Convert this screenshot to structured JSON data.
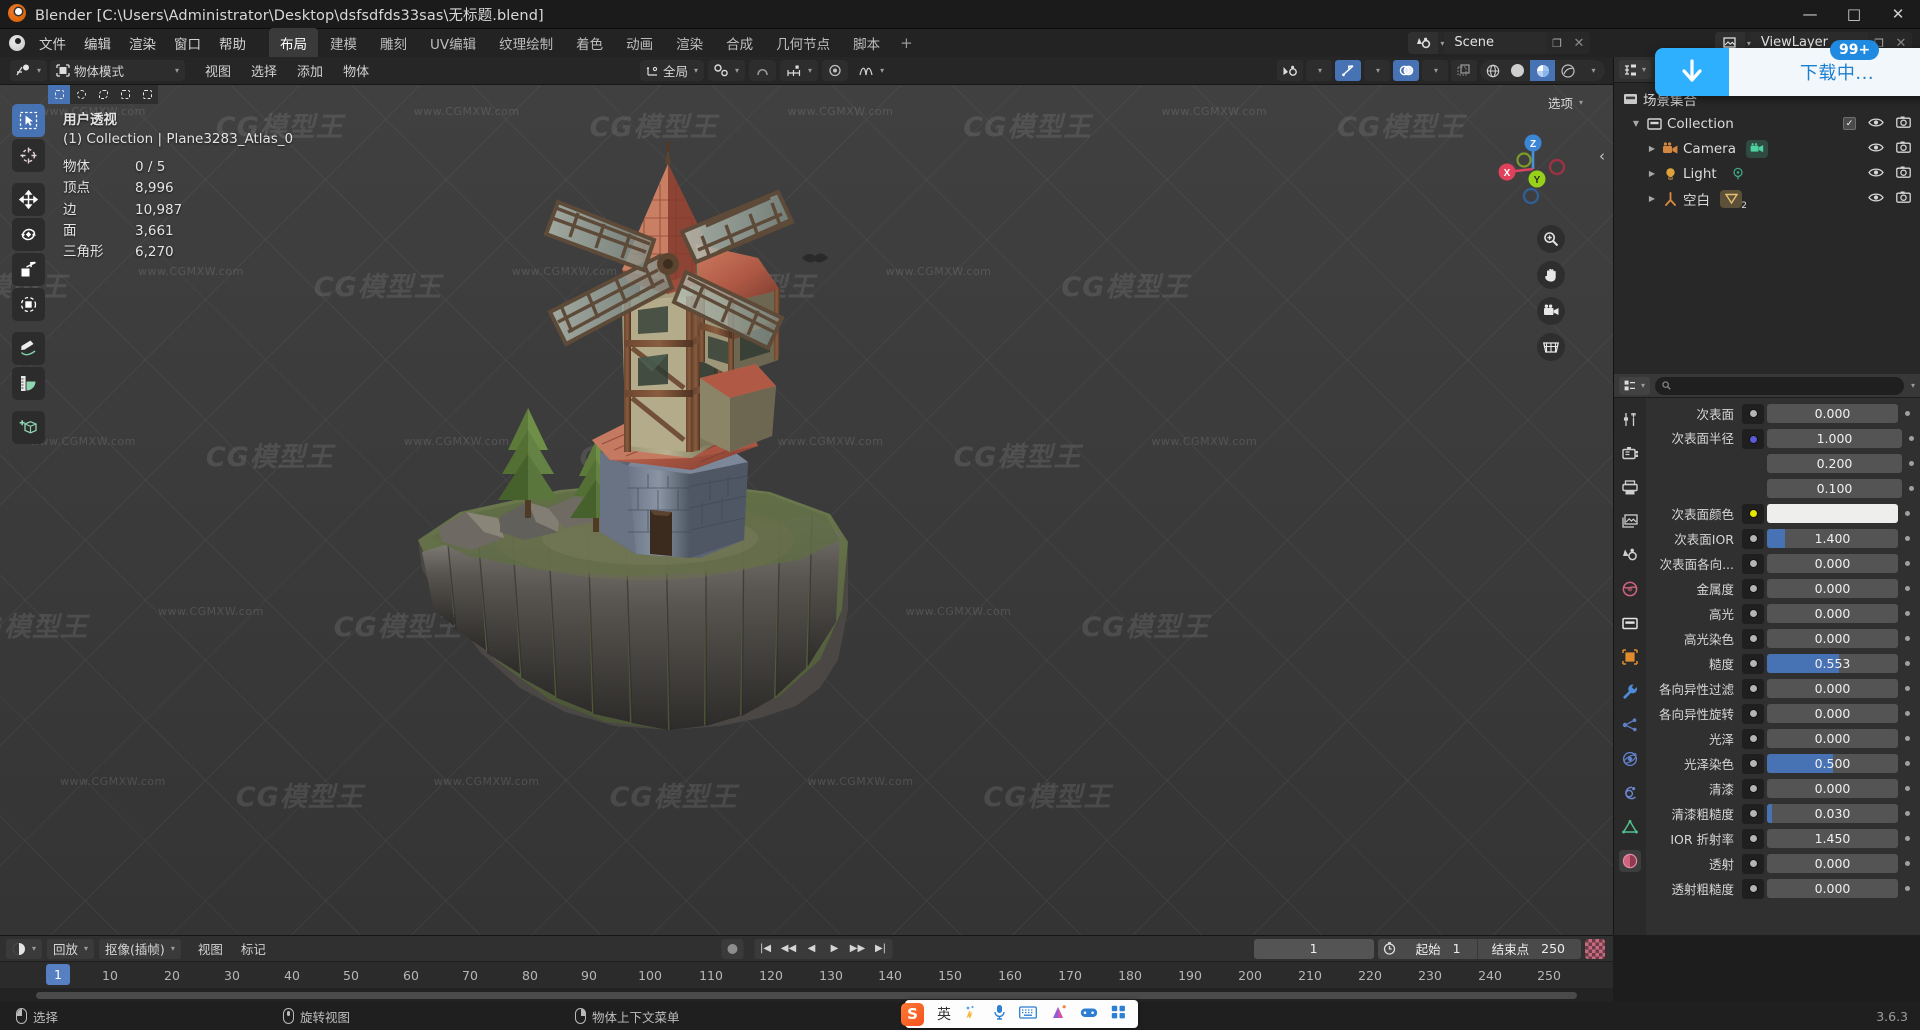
{
  "window": {
    "title": "Blender [C:\\Users\\Administrator\\Desktop\\dsfsdfds33sas\\无标题.blend]",
    "minimize": "—",
    "maximize": "□",
    "close": "✕"
  },
  "topbar": {
    "menus": [
      "文件",
      "编辑",
      "渲染",
      "窗口",
      "帮助"
    ],
    "workspaces": [
      "布局",
      "建模",
      "雕刻",
      "UV编辑",
      "纹理绘制",
      "着色",
      "动画",
      "渲染",
      "合成",
      "几何节点",
      "脚本"
    ],
    "active_workspace": "布局",
    "add_workspace": "+",
    "scene_name": "Scene",
    "viewlayer_name": "ViewLayer"
  },
  "download_toast": {
    "label": "下载中...",
    "badge": "99+"
  },
  "viewport_header": {
    "mode": "物体模式",
    "menus": [
      "视图",
      "选择",
      "添加",
      "物体"
    ],
    "transform_orientation": "全局"
  },
  "viewport": {
    "perspective": "用户透视",
    "active_object": "(1) Collection | Plane3283_Atlas_0",
    "options_label": "选项",
    "stats": [
      {
        "key": "物体",
        "value": "0 / 5"
      },
      {
        "key": "顶点",
        "value": "8,996"
      },
      {
        "key": "边",
        "value": "10,987"
      },
      {
        "key": "面",
        "value": "3,661"
      },
      {
        "key": "三角形",
        "value": "6,270"
      }
    ],
    "gizmo_axes": [
      "Z",
      "Y",
      "X"
    ],
    "watermark_logo": "CG模型王",
    "watermark_url": "www.CGMXW.com"
  },
  "outliner": {
    "search_placeholder": "",
    "scene_collection": "场景集合",
    "rows": [
      {
        "label": "Collection",
        "icon": "collection-icon",
        "indent": 0,
        "has_checkbox": true,
        "badge": ""
      },
      {
        "label": "Camera",
        "icon": "camera-object-icon",
        "indent": 1,
        "has_checkbox": false,
        "badge": "camera-data"
      },
      {
        "label": "Light",
        "icon": "light-object-icon",
        "indent": 1,
        "has_checkbox": false,
        "badge": "light-data"
      },
      {
        "label": "空白",
        "icon": "empty-object-icon",
        "indent": 1,
        "has_checkbox": false,
        "badge": "2"
      }
    ]
  },
  "properties": {
    "rows": [
      {
        "label": "次表面",
        "value": "0.000",
        "type": "slider",
        "fill": 0,
        "socket": "#b4b4b4"
      },
      {
        "label": "次表面半径",
        "value": "",
        "type": "group",
        "socket": "#5a5ad6",
        "values": [
          "1.000",
          "0.200",
          "0.100"
        ]
      },
      {
        "label": "次表面颜色",
        "value": "",
        "type": "color",
        "color": "#eeeeec",
        "socket": "#e6e600"
      },
      {
        "label": "次表面IOR",
        "value": "1.400",
        "type": "slider",
        "fill": 14,
        "socket": "#b4b4b4"
      },
      {
        "label": "次表面各向...",
        "value": "0.000",
        "type": "slider",
        "fill": 0,
        "socket": "#b4b4b4"
      },
      {
        "label": "金属度",
        "value": "0.000",
        "type": "slider",
        "fill": 0,
        "socket": "#b4b4b4"
      },
      {
        "label": "高光",
        "value": "0.000",
        "type": "slider",
        "fill": 0,
        "socket": "#b4b4b4"
      },
      {
        "label": "高光染色",
        "value": "0.000",
        "type": "slider",
        "fill": 0,
        "socket": "#b4b4b4"
      },
      {
        "label": "糙度",
        "value": "0.553",
        "type": "slider",
        "fill": 55,
        "socket": "#b4b4b4"
      },
      {
        "label": "各向异性过滤",
        "value": "0.000",
        "type": "slider",
        "fill": 0,
        "socket": "#b4b4b4"
      },
      {
        "label": "各向异性旋转",
        "value": "0.000",
        "type": "slider",
        "fill": 0,
        "socket": "#b4b4b4"
      },
      {
        "label": "光泽",
        "value": "0.000",
        "type": "slider",
        "fill": 0,
        "socket": "#b4b4b4"
      },
      {
        "label": "光泽染色",
        "value": "0.500",
        "type": "slider",
        "fill": 50,
        "socket": "#b4b4b4"
      },
      {
        "label": "清漆",
        "value": "0.000",
        "type": "slider",
        "fill": 0,
        "socket": "#b4b4b4"
      },
      {
        "label": "清漆粗糙度",
        "value": "0.030",
        "type": "slider",
        "fill": 4,
        "socket": "#b4b4b4"
      },
      {
        "label": "IOR 折射率",
        "value": "1.450",
        "type": "slider",
        "fill": 0,
        "socket": "#b4b4b4"
      },
      {
        "label": "透射",
        "value": "0.000",
        "type": "slider",
        "fill": 0,
        "socket": "#b4b4b4"
      },
      {
        "label": "透射粗糙度",
        "value": "0.000",
        "type": "slider",
        "fill": 0,
        "socket": "#b4b4b4"
      }
    ]
  },
  "timeline": {
    "editor_menu": "回放",
    "keying_menu": "抠像(插帧)",
    "menus": [
      "视图",
      "标记"
    ],
    "current_frame": "1",
    "start_label": "起始",
    "start_value": "1",
    "end_label": "结束点",
    "end_value": "250",
    "playhead_frame": "1",
    "ticks": [
      "10",
      "20",
      "30",
      "40",
      "50",
      "60",
      "70",
      "80",
      "90",
      "100",
      "110",
      "120",
      "130",
      "140",
      "150",
      "160",
      "170",
      "180",
      "190",
      "200",
      "210",
      "220",
      "230",
      "240",
      "250"
    ]
  },
  "statusbar": {
    "items": [
      {
        "mouse": "left",
        "label": "选择"
      },
      {
        "mouse": "middle",
        "label": "旋转视图"
      },
      {
        "mouse": "right",
        "label": "物体上下文菜单"
      }
    ],
    "version": "3.6.3"
  },
  "ime": {
    "brand": "S",
    "mode": "英",
    "icons": [
      "weather-icon",
      "mic-icon",
      "keyboard-icon",
      "skin-icon",
      "game-icon",
      "apps-icon"
    ]
  },
  "colors": {
    "accent_blue": "#4772b3",
    "orange": "#e87d0d",
    "toast_blue": "#2eb0ff"
  }
}
